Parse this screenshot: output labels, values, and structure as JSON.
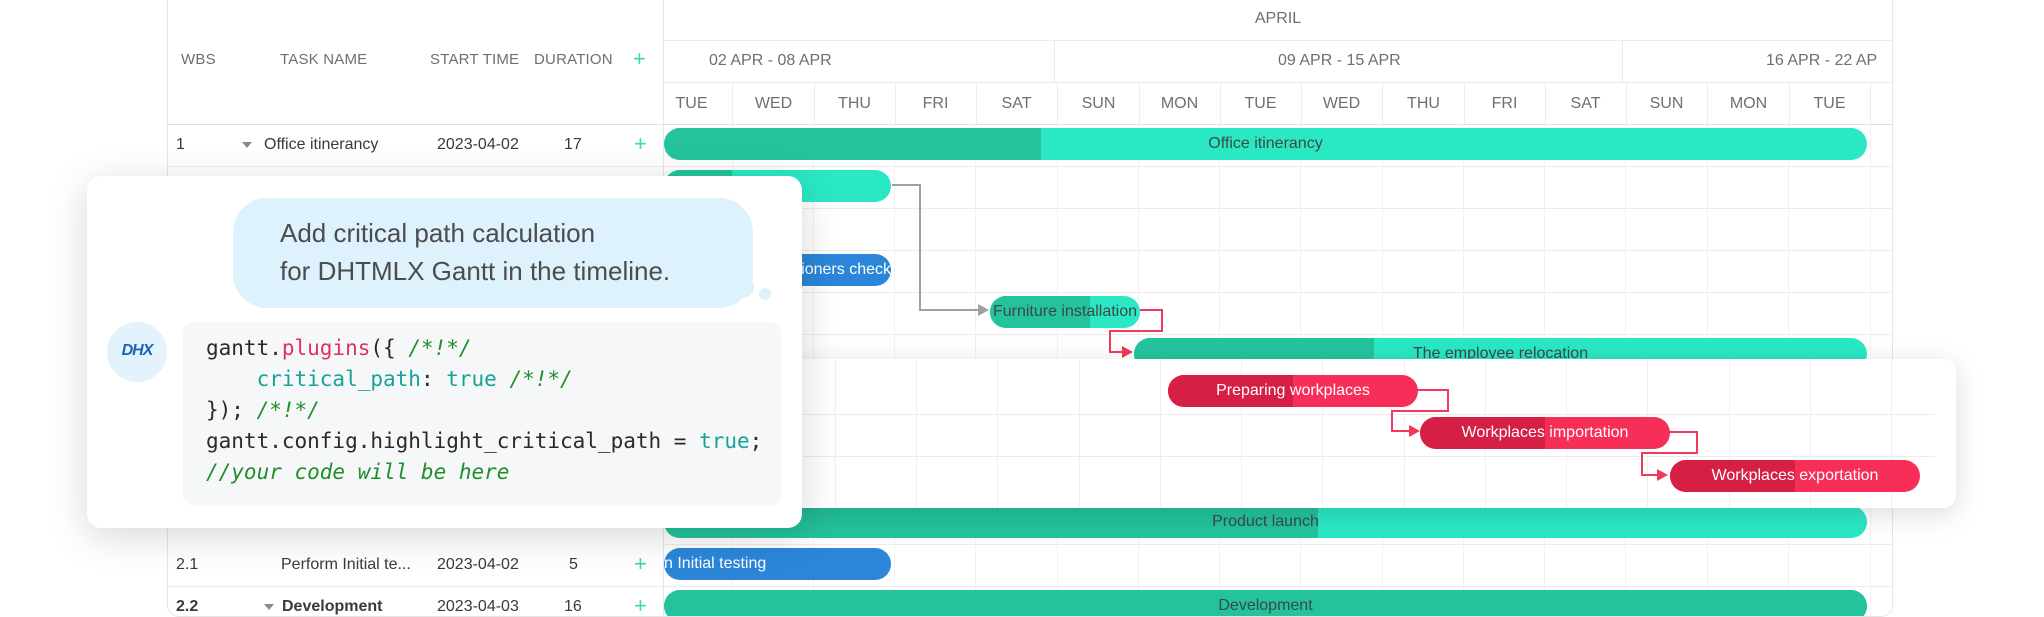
{
  "grid": {
    "headers": {
      "wbs": "WBS",
      "task_name": "TASK NAME",
      "start_time": "START TIME",
      "duration": "DURATION",
      "add": "+"
    },
    "rows": [
      {
        "wbs": "1",
        "name": "Office itinerancy",
        "start": "2023-04-02",
        "duration": "17",
        "expanded": true
      },
      {
        "wbs": "2.1",
        "name": "Perform Initial te...",
        "start": "2023-04-02",
        "duration": "5",
        "expanded": false
      },
      {
        "wbs": "2.2",
        "name": "Development",
        "start": "2023-04-03",
        "duration": "16",
        "expanded": true
      }
    ]
  },
  "timeline": {
    "month": "APRIL",
    "weeks": [
      "02 APR - 08 APR",
      "09 APR - 15 APR",
      "16 APR - 22 AP"
    ],
    "days": [
      "TUE",
      "WED",
      "THU",
      "FRI",
      "SAT",
      "SUN",
      "MON",
      "TUE",
      "WED",
      "THU",
      "FRI",
      "SAT",
      "SUN",
      "MON",
      "TUE"
    ]
  },
  "bars": {
    "office_itinerancy": "Office itinerancy",
    "commissioners_check": "ioners check",
    "furniture_installation": "Furniture installation",
    "employee_relocation": "The employee relocation",
    "product_launch": "Product launch",
    "initial_testing": "n Initial testing",
    "development": "Development"
  },
  "critical": {
    "preparing": "Preparing workplaces",
    "importation": "Workplaces importation",
    "exportation": "Workplaces exportation"
  },
  "chat": {
    "prompt_line1": "Add critical path calculation",
    "prompt_line2": "for DHTMLX Gantt in the timeline.",
    "avatar": "DHX",
    "code": {
      "l1a": "gantt.",
      "l1b": "plugins",
      "l1c": "({ ",
      "l1d": "/*!*/",
      "l2a": "    critical_path",
      "l2b": ": ",
      "l2c": "true",
      "l2d": " /*!*/",
      "l3a": "}); ",
      "l3b": "/*!*/",
      "l4a": "gantt.config.highlight_critical_path = ",
      "l4b": "true",
      "l4c": ";",
      "l5": "//your code will be here"
    }
  },
  "colors": {
    "teal": "#2ae8c4",
    "teal_progress": "#24c39d",
    "blue": "#2b86d9",
    "critical": "#f72e58",
    "bubble": "#ddf2fd"
  }
}
